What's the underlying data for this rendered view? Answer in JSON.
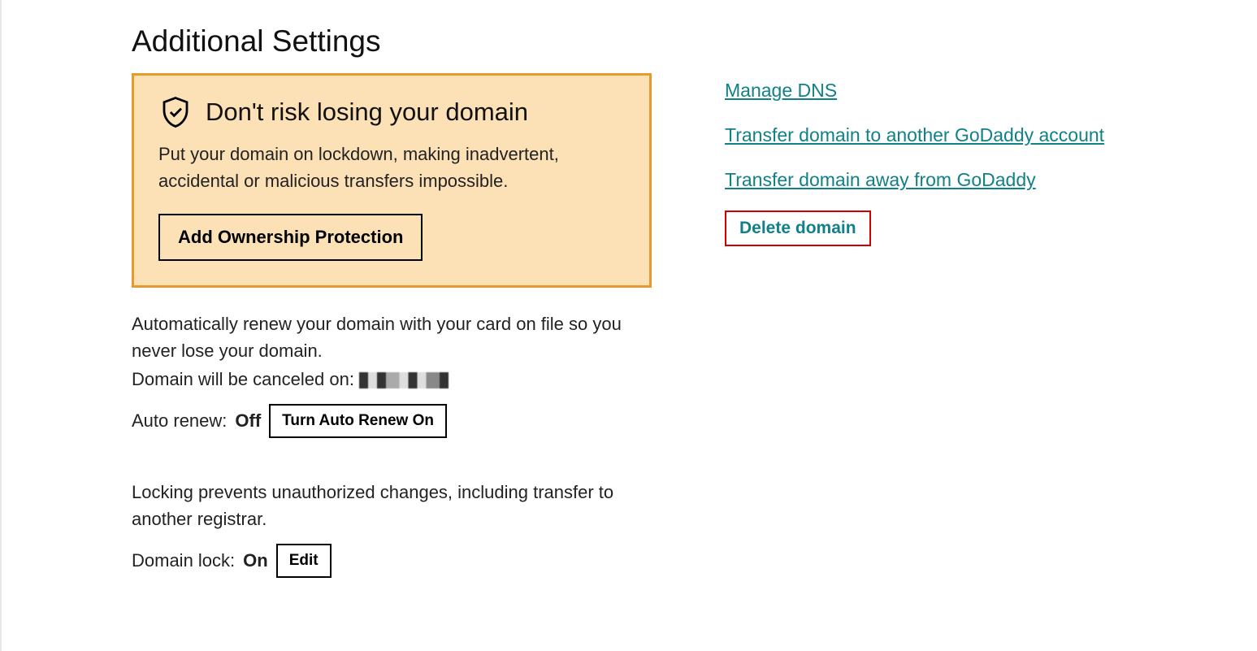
{
  "page": {
    "title": "Additional Settings"
  },
  "warning": {
    "title": "Don't risk losing your domain",
    "description": "Put your domain on lockdown, making inadvertent, accidental or malicious transfers impossible.",
    "button": "Add Ownership Protection"
  },
  "autoRenew": {
    "description": "Automatically renew your domain with your card on file so you never lose your domain.",
    "cancelPrefix": "Domain will be canceled on:",
    "cancelDate": "",
    "label": "Auto renew:",
    "status": "Off",
    "button": "Turn Auto Renew On"
  },
  "domainLock": {
    "description": "Locking prevents unauthorized changes, including transfer to another registrar.",
    "label": "Domain lock:",
    "status": "On",
    "button": "Edit"
  },
  "links": {
    "manageDns": "Manage DNS",
    "transferAccount": "Transfer domain to another GoDaddy account",
    "transferAway": "Transfer domain away from GoDaddy",
    "delete": "Delete domain"
  },
  "colors": {
    "link": "#118089",
    "warningBorder": "#e59a2c",
    "warningBg": "#fce1b6",
    "highlightBorder": "#d40000"
  }
}
